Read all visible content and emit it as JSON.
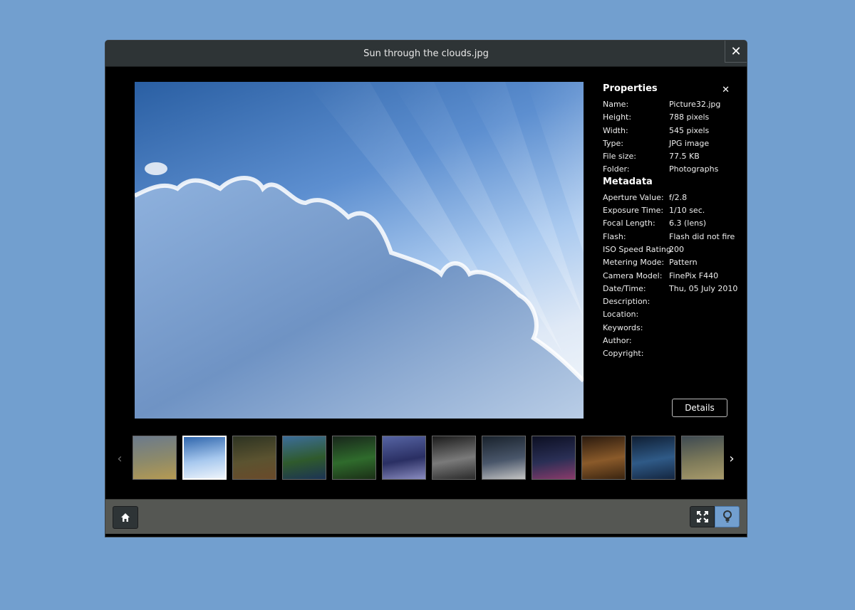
{
  "window": {
    "title": "Sun through the clouds.jpg"
  },
  "properties": {
    "heading": "Properties",
    "rows": [
      {
        "key": "Name:",
        "value": "Picture32.jpg"
      },
      {
        "key": "Height:",
        "value": "788 pixels"
      },
      {
        "key": "Width:",
        "value": "545 pixels"
      },
      {
        "key": "Type:",
        "value": "JPG image"
      },
      {
        "key": "File size:",
        "value": "77.5 KB"
      },
      {
        "key": "Folder:",
        "value": "Photographs"
      }
    ]
  },
  "metadata": {
    "heading": "Metadata",
    "rows": [
      {
        "key": "Aperture Value:",
        "value": "f/2.8"
      },
      {
        "key": "Exposure Time:",
        "value": "1/10 sec."
      },
      {
        "key": "Focal Length:",
        "value": "6.3 (lens)"
      },
      {
        "key": "Flash:",
        "value": "Flash did not fire"
      },
      {
        "key": "ISO Speed Rating:",
        "value": "200"
      },
      {
        "key": "Metering Mode:",
        "value": "Pattern"
      },
      {
        "key": "Camera Model:",
        "value": "FinePix F440"
      },
      {
        "key": "Date/Time:",
        "value": "Thu, 05 July 2010"
      },
      {
        "key": "Description:",
        "value": ""
      },
      {
        "key": "Location:",
        "value": ""
      },
      {
        "key": "Keywords:",
        "value": ""
      },
      {
        "key": "Author:",
        "value": ""
      },
      {
        "key": "Copyright:",
        "value": ""
      }
    ]
  },
  "details_label": "Details",
  "thumbnails": [
    {
      "name": "grass-field",
      "colors": [
        "#6b7a8c",
        "#8d8a6a",
        "#b59a52"
      ]
    },
    {
      "name": "sun-clouds",
      "colors": [
        "#2f66ad",
        "#a7c8ee",
        "#eef4fb"
      ],
      "selected": true
    },
    {
      "name": "forest-path",
      "colors": [
        "#2d3322",
        "#5b5330",
        "#6a4a2a"
      ]
    },
    {
      "name": "island-lake",
      "colors": [
        "#3c6d9a",
        "#2f5a2c",
        "#1c3354"
      ]
    },
    {
      "name": "green-valley",
      "colors": [
        "#18261b",
        "#2f6b2c",
        "#1b2f17"
      ]
    },
    {
      "name": "city-reflection",
      "colors": [
        "#5664a3",
        "#2a2f63",
        "#8a8cc0"
      ]
    },
    {
      "name": "starburst-lights",
      "colors": [
        "#1b1b1b",
        "#7a7a7a",
        "#2a2a2a"
      ]
    },
    {
      "name": "night-road",
      "colors": [
        "#19222c",
        "#49566a",
        "#c4c4c4"
      ]
    },
    {
      "name": "night-skyline",
      "colors": [
        "#0c0f22",
        "#2a2f55",
        "#8a3a6a"
      ]
    },
    {
      "name": "golden-grid",
      "colors": [
        "#2a1a0e",
        "#8a5a2a",
        "#3a2410"
      ]
    },
    {
      "name": "blue-trees",
      "colors": [
        "#0f1e33",
        "#2f5a87",
        "#142640"
      ]
    },
    {
      "name": "moor-hills",
      "colors": [
        "#3e4a52",
        "#7d7a5a",
        "#a89a6a"
      ]
    }
  ],
  "colors": {
    "background": "#729fcf",
    "accent": "#729fcf",
    "toolbar": "#555753"
  }
}
